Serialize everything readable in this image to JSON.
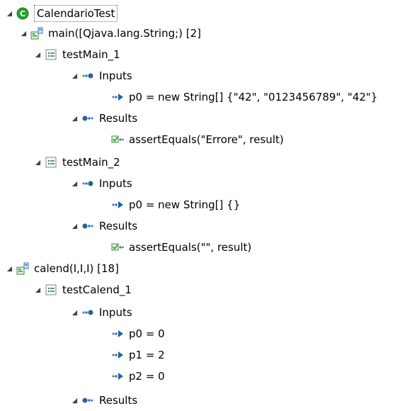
{
  "tree": {
    "root": {
      "label": "CalendarioTest",
      "icon": "class-icon",
      "color": "#2ca02c"
    },
    "nodes": [
      {
        "label": "main([Qjava.lang.String;) [2]",
        "icon": "method-suite-icon"
      },
      {
        "label": "testMain_1",
        "icon": "test-case-icon"
      },
      {
        "label": "Inputs",
        "icon": "inputs-icon"
      },
      {
        "label": "p0 = new String[] {\"42\", \"0123456789\", \"42\"}",
        "icon": "input-value-icon"
      },
      {
        "label": "Results",
        "icon": "results-icon"
      },
      {
        "label": "assertEquals(\"Errore\", result)",
        "icon": "assert-icon"
      },
      {
        "label": "testMain_2",
        "icon": "test-case-icon"
      },
      {
        "label": "Inputs",
        "icon": "inputs-icon"
      },
      {
        "label": "p0 = new String[] {}",
        "icon": "input-value-icon"
      },
      {
        "label": "Results",
        "icon": "results-icon"
      },
      {
        "label": "assertEquals(\"\", result)",
        "icon": "assert-icon"
      },
      {
        "label": "calend(I,I,I) [18]",
        "icon": "method-suite-icon"
      },
      {
        "label": "testCalend_1",
        "icon": "test-case-icon"
      },
      {
        "label": "Inputs",
        "icon": "inputs-icon"
      },
      {
        "label": "p0 = 0",
        "icon": "input-value-icon"
      },
      {
        "label": "p1 = 2",
        "icon": "input-value-icon"
      },
      {
        "label": "p2 = 0",
        "icon": "input-value-icon"
      },
      {
        "label": "Results",
        "icon": "results-icon"
      }
    ]
  }
}
